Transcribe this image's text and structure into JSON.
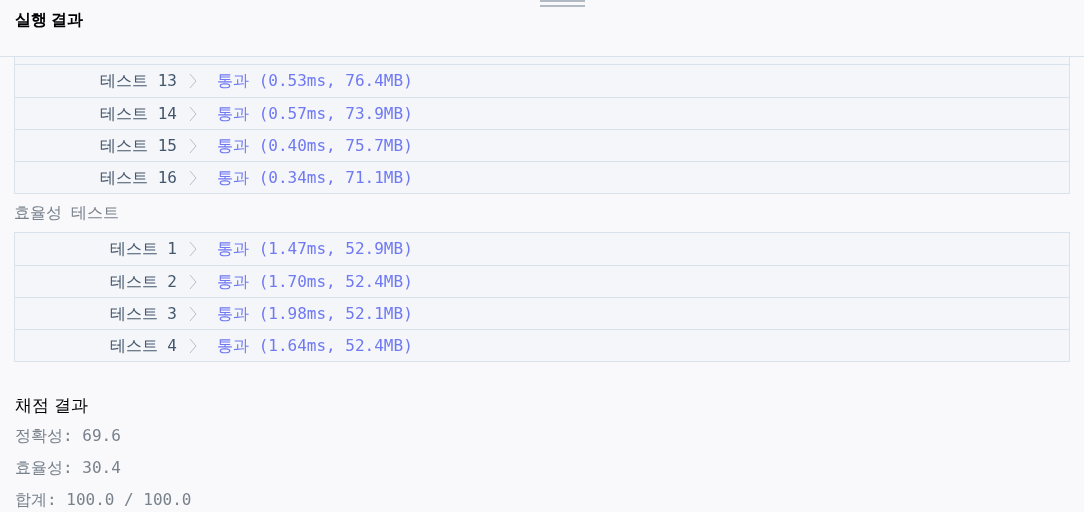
{
  "header": {
    "title": "실행 결과"
  },
  "groups": [
    {
      "rows": [
        {
          "label": "테스트 13",
          "result": "통과 (0.53ms, 76.4MB)"
        },
        {
          "label": "테스트 14",
          "result": "통과 (0.57ms, 73.9MB)"
        },
        {
          "label": "테스트 15",
          "result": "통과 (0.40ms, 75.7MB)"
        },
        {
          "label": "테스트 16",
          "result": "통과 (0.34ms, 71.1MB)"
        }
      ]
    },
    {
      "heading": "효율성  테스트",
      "rows": [
        {
          "label": "테스트 1",
          "result": "통과 (1.47ms, 52.9MB)"
        },
        {
          "label": "테스트 2",
          "result": "통과 (1.70ms, 52.4MB)"
        },
        {
          "label": "테스트 3",
          "result": "통과 (1.98ms, 52.1MB)"
        },
        {
          "label": "테스트 4",
          "result": "통과 (1.64ms, 52.4MB)"
        }
      ]
    }
  ],
  "score": {
    "title": "채점 결과",
    "lines": [
      "정확성: 69.6",
      "효율성: 30.4",
      "합계: 100.0 / 100.0"
    ]
  }
}
